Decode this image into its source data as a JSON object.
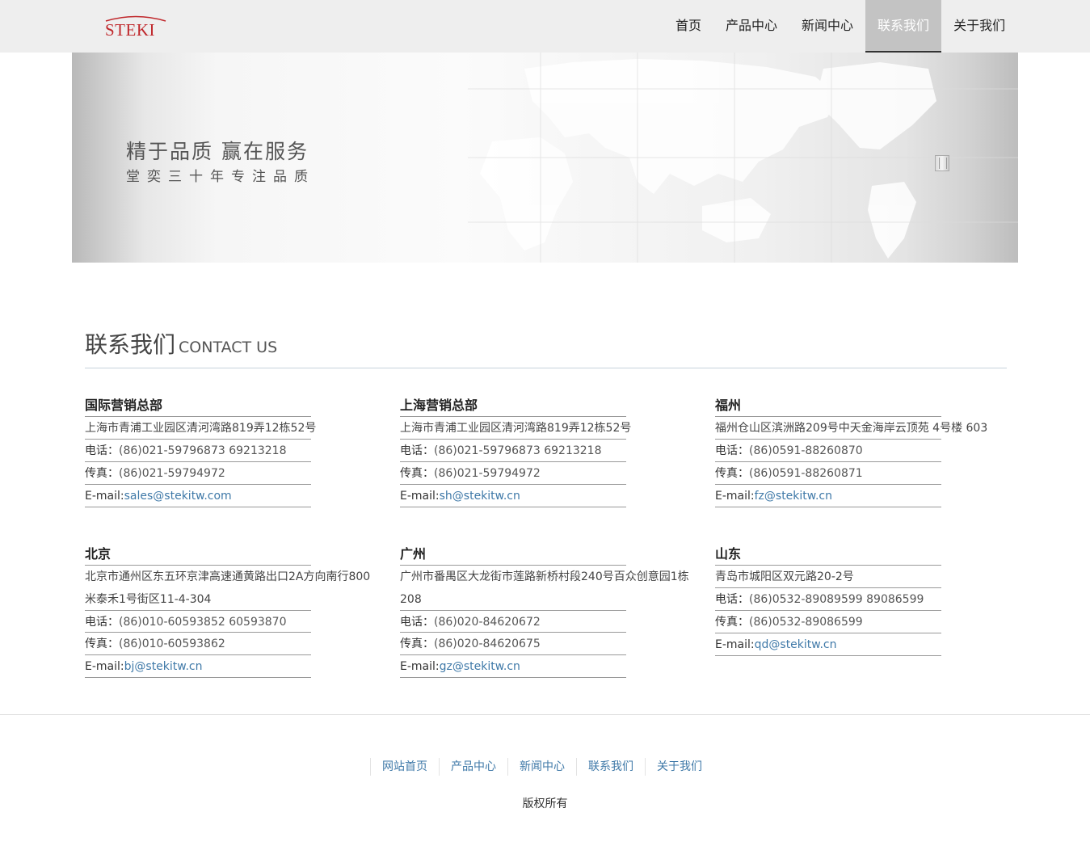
{
  "header": {
    "logo_text": "STEKI",
    "nav": [
      {
        "label": "首页"
      },
      {
        "label": "产品中心"
      },
      {
        "label": "新闻中心"
      },
      {
        "label": "联系我们",
        "active": true
      },
      {
        "label": "关于我们"
      }
    ]
  },
  "banner": {
    "title": "精于品质 赢在服务",
    "subtitle": "堂奕三十年专注品质"
  },
  "section": {
    "title_zh": "联系我们",
    "title_en": "CONTACT US"
  },
  "offices": [
    {
      "name": "国际营销总部",
      "address": "上海市青浦工业园区清河湾路819弄12栋52号",
      "phone_label": "电话：",
      "phone": "(86)021-59796873 69213218",
      "fax_label": "传真：",
      "fax": "(86)021-59794972",
      "email_label": "E-mail:",
      "email": "sales@stekitw.com"
    },
    {
      "name": "上海营销总部",
      "address": "上海市青浦工业园区清河湾路819弄12栋52号",
      "phone_label": "电话：",
      "phone": "(86)021-59796873 69213218",
      "fax_label": "传真：",
      "fax": "(86)021-59794972",
      "email_label": "E-mail:",
      "email": "sh@stekitw.cn"
    },
    {
      "name": "福州",
      "address": "福州仓山区滨洲路209号中天金海岸云顶苑 4号楼 603",
      "phone_label": "电话：",
      "phone": "(86)0591-88260870",
      "fax_label": "传真：",
      "fax": "(86)0591-88260871",
      "email_label": "E-mail:",
      "email": "fz@stekitw.cn"
    },
    {
      "name": "北京",
      "address": "北京市通州区东五环京津高速通黄路出口2A方向南行800米泰禾1号街区11-4-304",
      "phone_label": "电话：",
      "phone": "(86)010-60593852 60593870",
      "fax_label": "传真：",
      "fax": "(86)010-60593862",
      "email_label": "E-mail:",
      "email": "bj@stekitw.cn"
    },
    {
      "name": "广州",
      "address": "广州市番禺区大龙街市莲路新桥村段240号百众创意园1栋208",
      "phone_label": "电话：",
      "phone": "(86)020-84620672",
      "fax_label": "传真：",
      "fax": "(86)020-84620675",
      "email_label": "E-mail:",
      "email": "gz@stekitw.cn"
    },
    {
      "name": "山东",
      "address": "青岛市城阳区双元路20-2号",
      "phone_label": "电话：",
      "phone": "(86)0532-89089599 89086599",
      "fax_label": "传真：",
      "fax": "(86)0532-89086599",
      "email_label": "E-mail:",
      "email": "qd@stekitw.cn"
    }
  ],
  "footer": {
    "links": [
      "网站首页",
      "产品中心",
      "新闻中心",
      "联系我们",
      "关于我们"
    ],
    "copyright": "版权所有"
  },
  "colors": {
    "header_bg": "#eeeeee",
    "active_nav_bg": "#c3c3c3",
    "link": "#3f79a8",
    "logo": "#c0282c"
  }
}
